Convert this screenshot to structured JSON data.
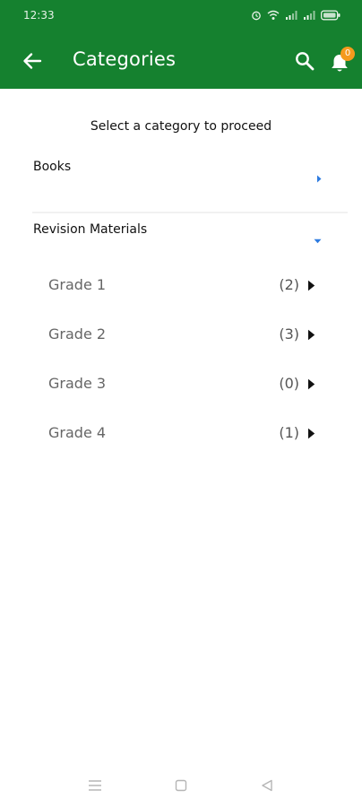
{
  "status_bar": {
    "time": "12:33"
  },
  "toolbar": {
    "title": "Categories",
    "notification_count": "0"
  },
  "subtitle": "Select a category to proceed",
  "categories": [
    {
      "label": "Books",
      "expanded": false
    },
    {
      "label": "Revision Materials",
      "expanded": true
    }
  ],
  "subcategories": [
    {
      "label": "Grade 1",
      "count": "(2)"
    },
    {
      "label": "Grade 2",
      "count": "(3)"
    },
    {
      "label": "Grade 3",
      "count": "(0)"
    },
    {
      "label": "Grade 4",
      "count": "(1)"
    }
  ],
  "colors": {
    "header": "#15812f",
    "badge": "#f59a1d",
    "category_arrow": "#2d7be0"
  },
  "icons": {
    "back": "arrow-left-icon",
    "search": "search-icon",
    "notifications": "bell-icon",
    "nav_menu": "menu-icon",
    "nav_home": "square-icon",
    "nav_back": "triangle-back-icon"
  }
}
